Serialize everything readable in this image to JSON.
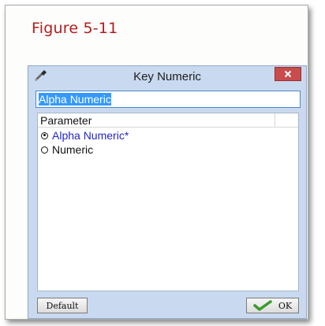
{
  "caption": "Figure 5-11",
  "dialog": {
    "title": "Key Numeric",
    "close_icon": "close-icon",
    "app_icon": "wrench-icon",
    "input_value": "Alpha Numeric",
    "list_header": "Parameter",
    "options": [
      {
        "label": "Alpha Numeric*",
        "selected": true
      },
      {
        "label": "Numeric",
        "selected": false
      }
    ],
    "default_label": "Default",
    "ok_label": "OK",
    "ok_icon": "checkmark-icon",
    "colors": {
      "dialog_bg": "#c9daf0",
      "close_button": "#c84c4c",
      "selection": "#3399ff",
      "active_option_text": "#2424c8",
      "caption_text": "#b11d1d",
      "ok_check": "#3a9a2a"
    }
  }
}
